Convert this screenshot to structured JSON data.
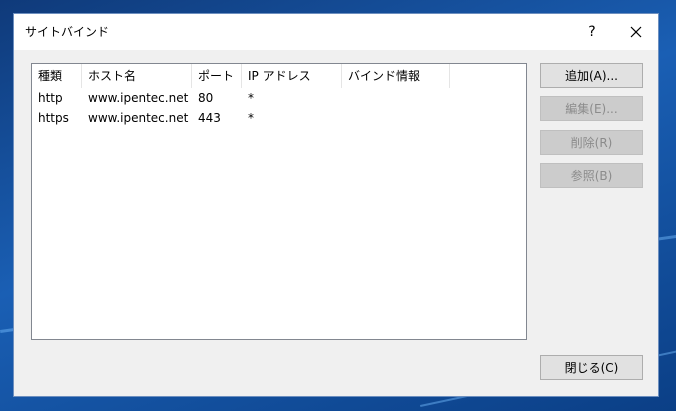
{
  "dialog": {
    "title": "サイトバインド",
    "help_label": "?"
  },
  "table": {
    "columns": [
      "種類",
      "ホスト名",
      "ポート",
      "IP アドレス",
      "バインド情報"
    ],
    "rows": [
      [
        "http",
        "www.ipentec.net",
        "80",
        "*",
        ""
      ],
      [
        "https",
        "www.ipentec.net",
        "443",
        "*",
        ""
      ]
    ]
  },
  "buttons": {
    "add": "追加(A)...",
    "edit": "編集(E)...",
    "remove": "削除(R)",
    "browse": "参照(B)",
    "close": "閉じる(C)"
  },
  "colors": {
    "desktop_blue": "#1a5fb4",
    "dialog_bg": "#f0f0f0",
    "disabled_text": "#8b8b8b"
  }
}
